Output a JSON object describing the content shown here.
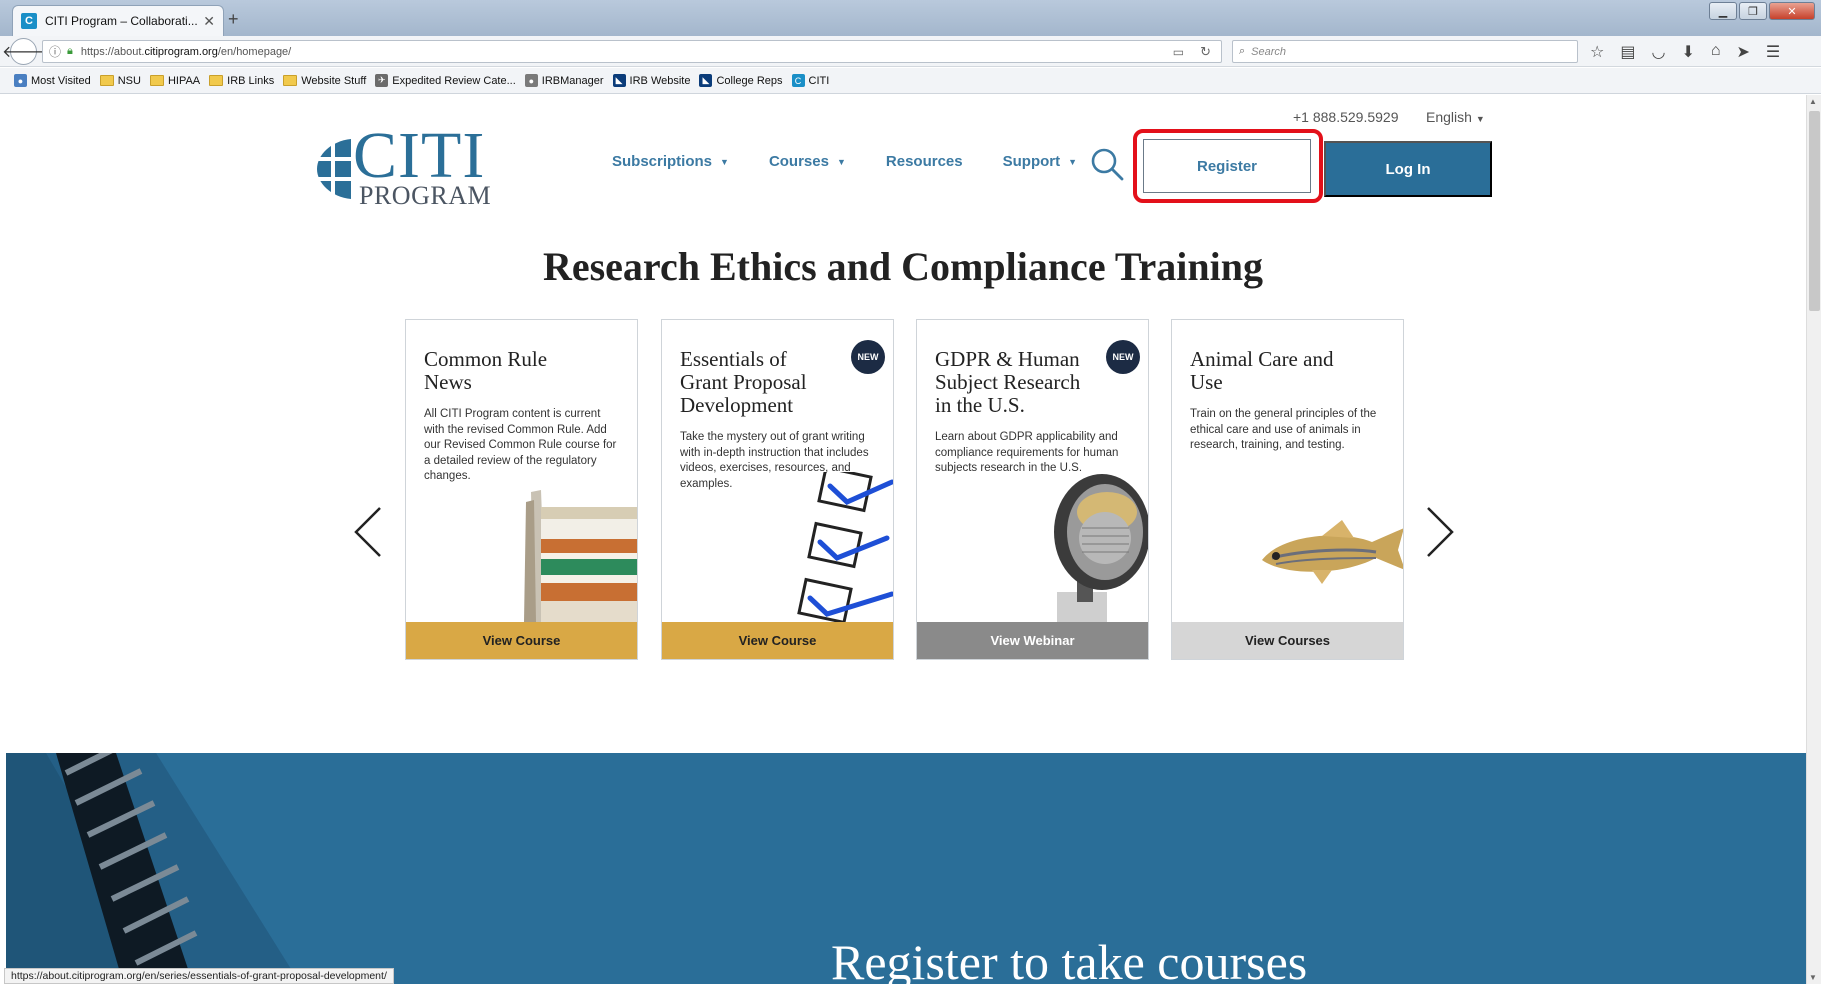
{
  "browser": {
    "tab_title": "CITI Program – Collaborati...",
    "tab_favicon": "C",
    "url_host_prefix": "https://about.",
    "url_host_domain": "citiprogram.org",
    "url_path": "/en/homepage/",
    "search_placeholder": "Search",
    "bookmarks": [
      {
        "label": "Most Visited",
        "icon": "most-visited-icon"
      },
      {
        "label": "NSU",
        "icon": "folder-icon"
      },
      {
        "label": "HIPAA",
        "icon": "folder-icon"
      },
      {
        "label": "IRB Links",
        "icon": "folder-icon"
      },
      {
        "label": "Website Stuff",
        "icon": "folder-icon"
      },
      {
        "label": "Expedited Review Cate...",
        "icon": "eagle-icon"
      },
      {
        "label": "IRBManager",
        "icon": "irbmanager-icon"
      },
      {
        "label": "IRB Website",
        "icon": "nsu-shark-icon"
      },
      {
        "label": "College Reps",
        "icon": "nsu-shark-icon"
      },
      {
        "label": "CITI",
        "icon": "citi-favicon-icon"
      }
    ],
    "status_url": "https://about.citiprogram.org/en/series/essentials-of-grant-proposal-development/"
  },
  "header": {
    "phone": "+1 888.529.5929",
    "language": "English",
    "logo_top": "CITI",
    "logo_bottom": "PROGRAM",
    "nav": [
      {
        "label": "Subscriptions",
        "has_caret": true
      },
      {
        "label": "Courses",
        "has_caret": true
      },
      {
        "label": "Resources",
        "has_caret": false
      },
      {
        "label": "Support",
        "has_caret": true
      }
    ],
    "register_label": "Register",
    "login_label": "Log In"
  },
  "main": {
    "headline": "Research Ethics and Compliance Training",
    "cards": [
      {
        "title_lines": [
          "Common Rule",
          "News"
        ],
        "description": "All CITI Program content is current with the revised Common Rule. Add our Revised Common Rule course for a detailed review of the regulatory changes.",
        "button": "View Course",
        "button_color": "#d9a845",
        "badge": ""
      },
      {
        "title_lines": [
          "Essentials of",
          "Grant Proposal",
          "Development"
        ],
        "description": "Take the mystery out of grant writing with in-depth instruction that includes videos, exercises, resources, and examples.",
        "button": "View Course",
        "button_color": "#d9a845",
        "badge": "NEW"
      },
      {
        "title_lines": [
          "GDPR & Human",
          "Subject Research",
          "in the U.S."
        ],
        "description": "Learn about GDPR applicability and compliance requirements for human subjects research in the U.S.",
        "button": "View Webinar",
        "button_color": "#8a8a8a",
        "badge": "NEW"
      },
      {
        "title_lines": [
          "Animal Care and",
          "Use"
        ],
        "description": "Train on the general principles of the ethical care and use of animals in research, training, and testing.",
        "button": "View Courses",
        "button_color": "#d6d6d6",
        "badge": ""
      }
    ],
    "register_section_headline": "Register to take courses"
  },
  "colors": {
    "brand_blue": "#2a6e98",
    "nav_blue": "#3c7aa3",
    "highlight_red": "#e3101a"
  }
}
